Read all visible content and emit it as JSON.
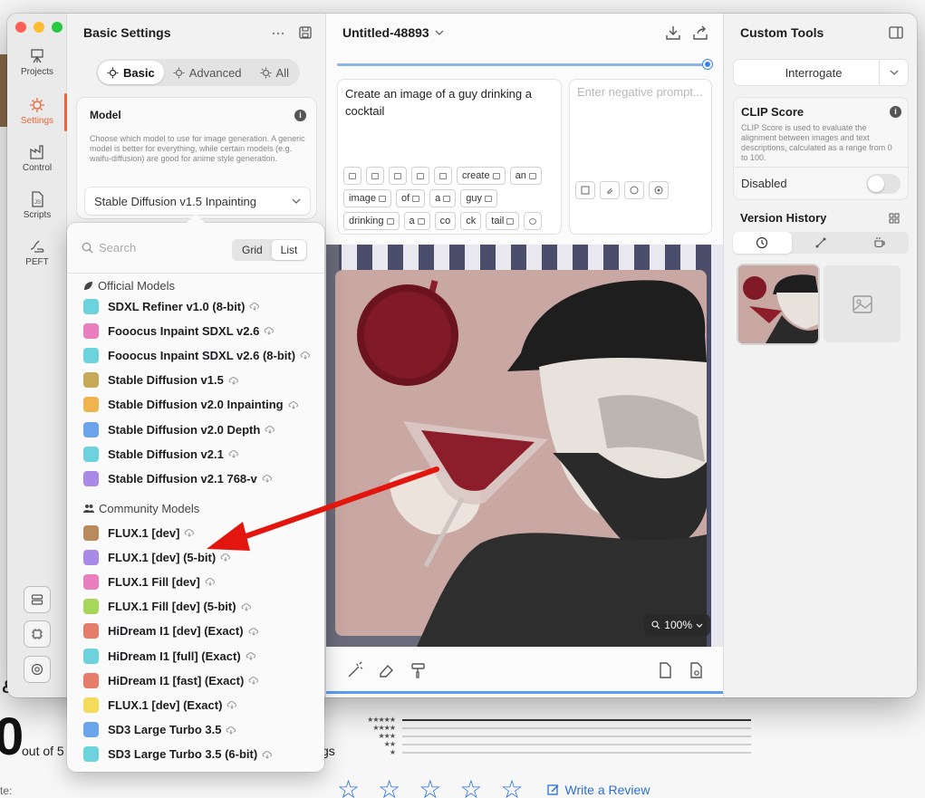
{
  "background": {
    "amp": "&",
    "rating_value": "0",
    "out_of": "out of 5",
    "ratings_suffix": "gs",
    "rate_label": "te:",
    "write_review": "Write a Review",
    "rating_stars": [
      "★★★★★",
      "★★★★",
      "★★★",
      "★★",
      "★"
    ]
  },
  "sidebar": {
    "items": [
      {
        "label": "Projects",
        "icon": "easel-icon"
      },
      {
        "label": "Settings",
        "icon": "sun-gear-icon"
      },
      {
        "label": "Control",
        "icon": "factory-icon"
      },
      {
        "label": "Scripts",
        "icon": "js-file-icon"
      },
      {
        "label": "PEFT",
        "icon": "hand-icon"
      }
    ],
    "bottom_buttons": [
      "server-icon",
      "chip-icon",
      "at-icon"
    ],
    "accent": "#e8663b"
  },
  "settings": {
    "title": "Basic Settings",
    "tabs": [
      {
        "label": "Basic",
        "active": true
      },
      {
        "label": "Advanced",
        "active": false
      },
      {
        "label": "All",
        "active": false
      }
    ],
    "model": {
      "title": "Model",
      "description": "Choose which model to use for image generation. A generic model is better for everything, while certain models (e.g. waifu-diffusion) are good for anime style generation.",
      "selected": "Stable Diffusion v1.5 Inpainting"
    }
  },
  "dropdown": {
    "search_placeholder": "Search",
    "view_modes": [
      "Grid",
      "List"
    ],
    "active_view": "List",
    "official_title": "Official Models",
    "community_title": "Community Models",
    "official": [
      {
        "name": "SDXL Refiner v1.0 (8-bit)",
        "color": "#6cd3dc"
      },
      {
        "name": "Fooocus Inpaint SDXL v2.6",
        "color": "#e97fbf"
      },
      {
        "name": "Fooocus Inpaint SDXL v2.6 (8-bit)",
        "color": "#6cd3dc"
      },
      {
        "name": "Stable Diffusion v1.5",
        "color": "#c6a957"
      },
      {
        "name": "Stable Diffusion v2.0 Inpainting",
        "color": "#f0b44f"
      },
      {
        "name": "Stable Diffusion v2.0 Depth",
        "color": "#6ba4ea"
      },
      {
        "name": "Stable Diffusion v2.1",
        "color": "#6cd3dc"
      },
      {
        "name": "Stable Diffusion v2.1 768-v",
        "color": "#a98be7"
      }
    ],
    "community": [
      {
        "name": "FLUX.1 [dev]",
        "color": "#b98a5c"
      },
      {
        "name": "FLUX.1 [dev] (5-bit)",
        "color": "#a98be7"
      },
      {
        "name": "FLUX.1 Fill [dev]",
        "color": "#e97fbf"
      },
      {
        "name": "FLUX.1 Fill [dev] (5-bit)",
        "color": "#a6d65a"
      },
      {
        "name": "HiDream I1 [dev] (Exact)",
        "color": "#e57d6a"
      },
      {
        "name": "HiDream I1 [full] (Exact)",
        "color": "#6cd3dc"
      },
      {
        "name": "HiDream I1 [fast] (Exact)",
        "color": "#e57d6a"
      },
      {
        "name": "FLUX.1 [dev] (Exact)",
        "color": "#f2dc5a"
      },
      {
        "name": "SD3 Large Turbo 3.5",
        "color": "#6ba4ea"
      },
      {
        "name": "SD3 Large Turbo 3.5 (6-bit)",
        "color": "#6cd3dc"
      }
    ]
  },
  "center": {
    "title": "Untitled-48893",
    "generation_progress": 1.0,
    "prompt": "Create an image of a guy drinking a cocktail",
    "tokens_row1": [
      "",
      "",
      "",
      "",
      "",
      "create",
      "an"
    ],
    "tokens_row2": [
      "image",
      "of",
      "a",
      "guy"
    ],
    "tokens_row3": [
      "drinking",
      "a",
      "co",
      "ck",
      "tail",
      ""
    ],
    "negative_placeholder": "Enter negative prompt...",
    "zoom": "100%"
  },
  "right": {
    "title": "Custom Tools",
    "interrogate": "Interrogate",
    "clip_title": "CLIP Score",
    "clip_desc": "CLIP Score is used to evaluate the alignment between images and text descriptions, calculated as a range from 0 to 100.",
    "clip_state": "Disabled",
    "version_history": "Version History"
  }
}
